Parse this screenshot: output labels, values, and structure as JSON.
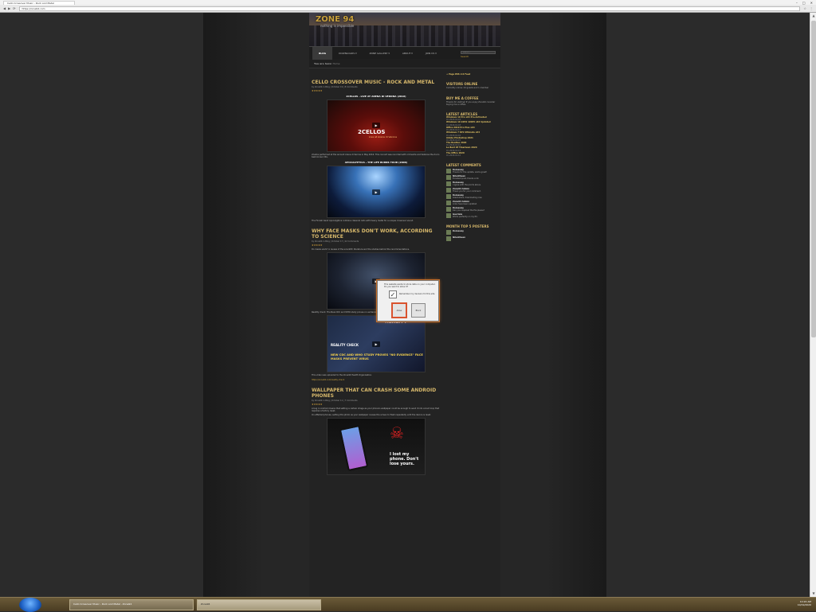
{
  "browser": {
    "tab_title": "Cello Crossover Music - Rock and Metal",
    "url": "https://zone94.com",
    "win_min": "–",
    "win_max": "□",
    "win_close": "✕",
    "nav_back": "◀",
    "nav_fwd": "▶",
    "nav_reload": "⟳",
    "tool_a": "☆",
    "tool_b": "⋮"
  },
  "site": {
    "logo": "ZONE 94",
    "logo_sub": "nothing is impossible",
    "nav": [
      {
        "label": "BLOG"
      },
      {
        "label": "DOWNLOADS ▾"
      },
      {
        "label": "ZONE GALLERY ▾"
      },
      {
        "label": "ABOUT ▾"
      },
      {
        "label": "JOIN US ▾"
      }
    ],
    "search_placeholder": "search...",
    "search_btn": "Search",
    "crumbs_prefix": "You are here:",
    "crumbs_current": "Home"
  },
  "posts": [
    {
      "title": "Cello Crossover Music - Rock and Metal",
      "meta": "by Zone94 in Blog | October 19 | 8 Comments",
      "stars": "★★★★★",
      "sub1": "2CELLOS - LIVE AT ARENA DI VERONA (2016)",
      "v1_caption": "2CELLOS",
      "v1_caption2": "Live at Arena di Verona",
      "text1": "2Cellos performed at the ancient Arena di Verona in May 2016. This concert was recorded with orchestra and features the duo's best known hits.",
      "sub2": "APOCALYPTICA - THE LIFE BURNS TOUR (2006)",
      "text2": "The Finnish band Apocalyptica combine classical cello with heavy metal for a unique crossover sound."
    },
    {
      "title": "Why Face Masks Don't Work, According to Science",
      "meta": "by Zone94 in Blog | October 17 | 22 Comments",
      "stars": "★★★★★",
      "text1": "Do masks work? A review of the scientific literature and the studies behind the recommendations.",
      "text2": "Reallity check: The New CDC and WHO study proves no evidence face masks prevent virus spread.",
      "v4_cap_a": "REALITY CHECK",
      "v4_cap_b": "NEW CDC AND WHO STUDY PROVES \"NO EVIDENCE\" FACE MASKS PREVENT VIRUS",
      "v4_cap_c": "REALITY",
      "text3": "This video was uploaded to the Zone94 Health Organisation.",
      "link1": "https://zone94.com/reality-check"
    },
    {
      "title": "Wallpaper That Can Crash Some Android Phones",
      "meta": "by Zone94 in Blog | October 11 | 7 Comments",
      "stars": "★★★★★",
      "text1": "A bug in Android means that setting a certain image as your phone's wallpaper could be enough to send it into a boot loop that requires a factory reset.",
      "text2": "On affected phones, setting this photo as your wallpaper causes the screen to flash repeatedly until the device is reset.",
      "v5_cap": "I lost my phone. Don't lose yours."
    }
  ],
  "sidebar": {
    "feed": "+ Page RSS 2.0 Feed",
    "visitors_title": "Visitors Online",
    "visitors_text": "Currently online: 24 guests and 1 member",
    "coffee_title": "Buy me a coffee",
    "coffee_text": "Thanks for visiting! If you enjoy Zone94 consider buying me a coffee.",
    "articles_title": "Latest Articles",
    "articles": [
      {
        "title": "Windows 10 Pro x64 Pre-Activated",
        "date": "On 2020-10-19"
      },
      {
        "title": "Windows 10 22H2 19045 x64 Updated",
        "date": "On 2020-10-18"
      },
      {
        "title": "Office 2019 Pro Plus x64",
        "date": "On 2020-10-17"
      },
      {
        "title": "Windows 7 SP1 Ultimate x64",
        "date": "On 2020-10-16"
      },
      {
        "title": "Adobe Photoshop 2021",
        "date": "On 2020-10-15"
      },
      {
        "title": "The Beatles 2020",
        "date": "On 2020-10-14"
      },
      {
        "title": "Le Best Of Tinariwen 2020",
        "date": "On 2020-10-13"
      },
      {
        "title": "The Office 2020",
        "date": "On 2020-10-12"
      }
    ],
    "comments_title": "Latest Comments",
    "comments": [
      {
        "name": "Romaway",
        "text": "Thanks for the update, works great!"
      },
      {
        "name": "Nilanthean",
        "text": "Excellent post, thanks a lot."
      },
      {
        "name": "Romaway",
        "text": "I agree with the points above."
      },
      {
        "name": "Zone94 Admin",
        "text": "Thank you for your comment."
      },
      {
        "name": "Romaway",
        "text": "Great share, downloading now."
      },
      {
        "name": "Zone94 Admin",
        "text": "Links have been updated."
      },
      {
        "name": "Romaway",
        "text": "Can you reupload the file please?"
      },
      {
        "name": "Gavriela",
        "text": "Works perfectly on my PC."
      }
    ],
    "top_title": "Month Top 5 Posters",
    "top": [
      {
        "name": "Romaway"
      },
      {
        "name": "Nilanthean"
      }
    ]
  },
  "dialog": {
    "text": "This website wants to store data on your computer. Do you want to allow it?",
    "check_mark": "✓",
    "check_label": "Remember my decision for this site",
    "ok": "Allow",
    "cancel": "Block"
  },
  "taskbar": {
    "task1": "Cello Crossover Music - Rock and Metal - Zone94",
    "task2": "Zone94",
    "time": "10:24 AM",
    "date": "10/19/2020"
  }
}
